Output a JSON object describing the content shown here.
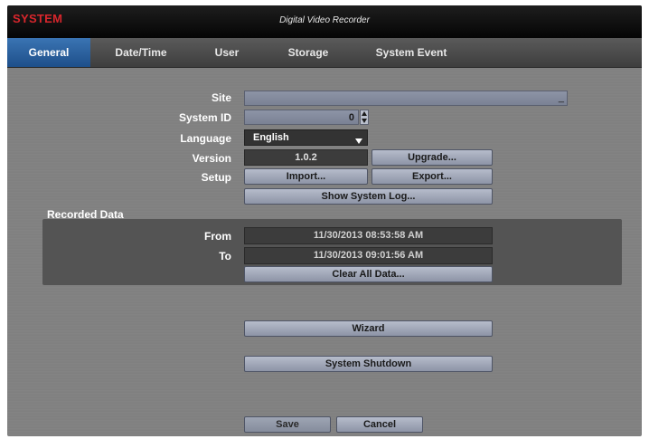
{
  "header": {
    "system_label": "SYSTEM",
    "title": "Digital Video Recorder"
  },
  "tabs": [
    {
      "label": "General",
      "active": true
    },
    {
      "label": "Date/Time",
      "active": false
    },
    {
      "label": "User",
      "active": false
    },
    {
      "label": "Storage",
      "active": false
    },
    {
      "label": "System Event",
      "active": false
    }
  ],
  "form": {
    "site_label": "Site",
    "site_value": "",
    "site_cursor": "_",
    "system_id_label": "System ID",
    "system_id_value": "0",
    "language_label": "Language",
    "language_value": "English",
    "version_label": "Version",
    "version_value": "1.0.2",
    "upgrade_label": "Upgrade...",
    "setup_label": "Setup",
    "import_label": "Import...",
    "export_label": "Export...",
    "show_log_label": "Show System Log..."
  },
  "recorded": {
    "section_label": "Recorded Data",
    "from_label": "From",
    "from_value": "11/30/2013  08:53:58 AM",
    "to_label": "To",
    "to_value": "11/30/2013  09:01:56 AM",
    "clear_label": "Clear All Data..."
  },
  "actions": {
    "wizard_label": "Wizard",
    "shutdown_label": "System Shutdown"
  },
  "footer": {
    "save_label": "Save",
    "cancel_label": "Cancel"
  },
  "colors": {
    "system_red": "#d8262c",
    "active_tab": "#2d66a6",
    "field_blue_grey": "#8d94a6"
  },
  "icons": {
    "dropdown": "chevron-down-icon",
    "stepper_up": "triangle-up-icon",
    "stepper_down": "triangle-down-icon"
  }
}
